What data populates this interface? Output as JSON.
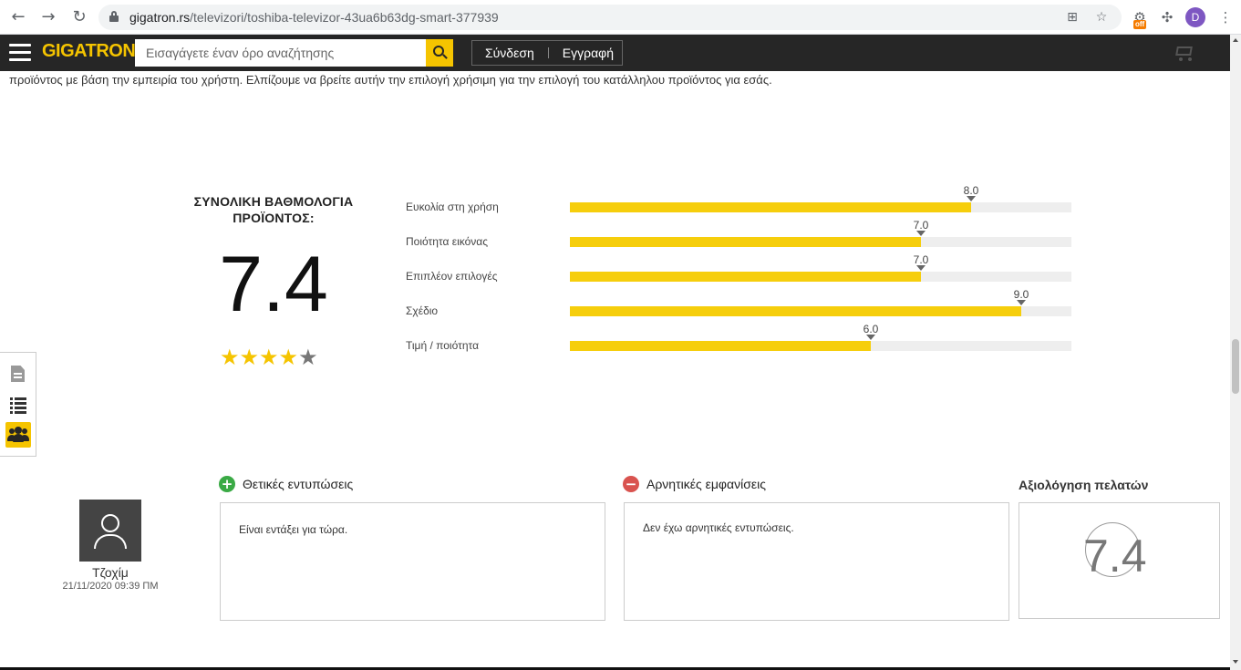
{
  "browser": {
    "url_host": "gigatron.rs",
    "url_path": "/televizori/toshiba-televizor-43ua6b63dg-smart-377939",
    "extension_badge": "off",
    "profile_initial": "D"
  },
  "header": {
    "logo": "GIGATRON",
    "search_placeholder": "Εισαγάγετε έναν όρο αναζήτησης",
    "login_label": "Σύνδεση",
    "register_label": "Εγγραφή"
  },
  "intro_text": "προϊόντος με βάση την εμπειρία του χρήστη. Ελπίζουμε να βρείτε αυτήν την επιλογή χρήσιμη για την επιλογή του κατάλληλου προϊόντος για εσάς.",
  "summary": {
    "title_line1": "ΣΥΝΟΛΙΚΗ ΒΑΘΜΟΛΟΓΙΑ",
    "title_line2": "ΠΡΟΪΟΝΤΟΣ:",
    "score": "7.4",
    "stars_filled": 4,
    "stars_total": 5
  },
  "criteria": [
    {
      "label": "Ευκολία στη χρήση",
      "value": "8.0",
      "score": 8.0
    },
    {
      "label": "Ποιότητα εικόνας",
      "value": "7.0",
      "score": 7.0
    },
    {
      "label": "Επιπλέον επιλογές",
      "value": "7.0",
      "score": 7.0
    },
    {
      "label": "Σχέδιο",
      "value": "9.0",
      "score": 9.0
    },
    {
      "label": "Τιμή / ποιότητα",
      "value": "6.0",
      "score": 6.0
    }
  ],
  "criteria_max": 10,
  "colors": {
    "accent": "#f6ce0c",
    "header_bg": "#262626",
    "positive": "#3aaa45",
    "negative": "#d9534f"
  },
  "review": {
    "reviewer_name": "Τζοχίμ",
    "date": "21/11/2020 09:39 ΠΜ",
    "positive_title": "Θετικές εντυπώσεις",
    "positive_text": "Είναι εντάξει για τώρα.",
    "negative_title": "Αρνητικές εμφανίσεις",
    "negative_text": "Δεν έχω αρνητικές εντυπώσεις.",
    "customer_rating_title": "Αξιολόγηση πελατών",
    "customer_score": "7.4"
  },
  "side_tools": [
    "document-icon",
    "list-icon",
    "users-icon"
  ]
}
